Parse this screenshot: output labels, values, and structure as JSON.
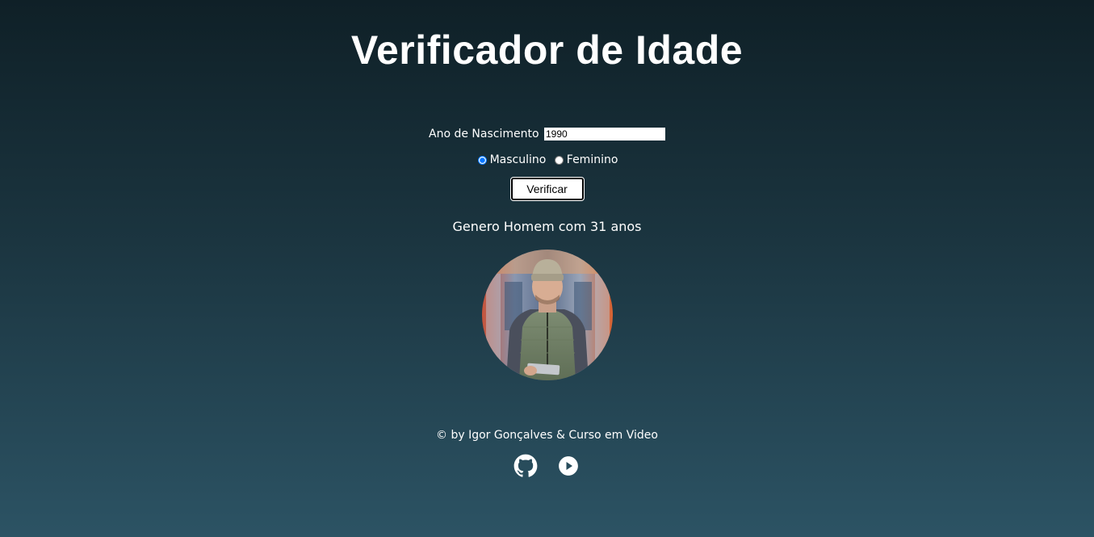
{
  "title": "Verificador de Idade",
  "form": {
    "year_label": "Ano de Nascimento",
    "year_value": "1990",
    "sex_options": [
      {
        "label": "Masculino",
        "checked": true
      },
      {
        "label": "Feminino",
        "checked": false
      }
    ],
    "verify_label": "Verificar"
  },
  "result": {
    "text": "Genero Homem com 31 anos",
    "photo_icon": "man-portrait-photo"
  },
  "footer": {
    "credit": "© by Igor Gonçalves & Curso em Video",
    "links": [
      {
        "icon": "github-icon"
      },
      {
        "icon": "youtube-icon"
      }
    ]
  }
}
